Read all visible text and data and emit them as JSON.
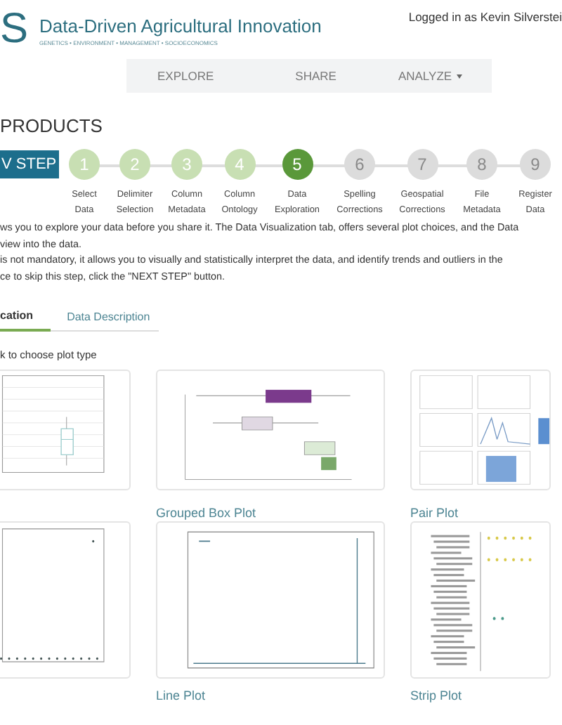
{
  "header": {
    "logo_letter": "S",
    "title": "Data-Driven Agricultural Innovation",
    "subtitle": "GENETICS • ENVIRONMENT • MANAGEMENT • SOCIOECONOMICS",
    "user": "Logged in as Kevin Silverstei"
  },
  "nav": [
    {
      "label": "EXPLORE",
      "dropdown": false
    },
    {
      "label": "SHARE",
      "dropdown": false
    },
    {
      "label": "ANALYZE",
      "dropdown": true
    }
  ],
  "page_title": "PRODUCTS",
  "next_button": "V STEP",
  "steps": [
    {
      "number": "1",
      "label": [
        "Select",
        "Data"
      ],
      "completed": true,
      "selected": false
    },
    {
      "number": "2",
      "label": [
        "Delimiter",
        "Selection"
      ],
      "completed": true,
      "selected": false
    },
    {
      "number": "3",
      "label": [
        "Column",
        "Metadata"
      ],
      "completed": true,
      "selected": false
    },
    {
      "number": "4",
      "label": [
        "Column",
        "Ontology"
      ],
      "completed": true,
      "selected": false
    },
    {
      "number": "5",
      "label": [
        "Data",
        "Exploration"
      ],
      "completed": false,
      "selected": true
    },
    {
      "number": "6",
      "label": [
        "Spelling",
        "Corrections"
      ],
      "completed": false,
      "selected": false
    },
    {
      "number": "7",
      "label": [
        "Geospatial",
        "Corrections"
      ],
      "completed": false,
      "selected": false
    },
    {
      "number": "8",
      "label": [
        "File",
        "Metadata"
      ],
      "completed": false,
      "selected": false
    },
    {
      "number": "9",
      "label": [
        "Register",
        "Data"
      ],
      "completed": false,
      "selected": false
    }
  ],
  "description": [
    "ws you to explore your data before you share it. The Data Visualization tab, offers several plot choices, and the Data",
    "view into the data.",
    "is not mandatory, it allows you to visually and statistically interpret the data, and identify trends and outliers in the",
    "ce to skip this step, click the \"NEXT STEP\" button."
  ],
  "tabs": [
    {
      "label": "cation",
      "selected": true
    },
    {
      "label": "Data Description",
      "selected": false
    }
  ],
  "hint": "k to choose plot type",
  "plots": [
    {
      "kind": "box"
    },
    {
      "kind": "grouped_box",
      "label": "Grouped Box Plot"
    },
    {
      "kind": "pair",
      "label": "Pair Plot"
    },
    {
      "kind": "scatter"
    },
    {
      "kind": "line",
      "label": "Line Plot"
    },
    {
      "kind": "strip",
      "label": "Strip Plot"
    }
  ]
}
